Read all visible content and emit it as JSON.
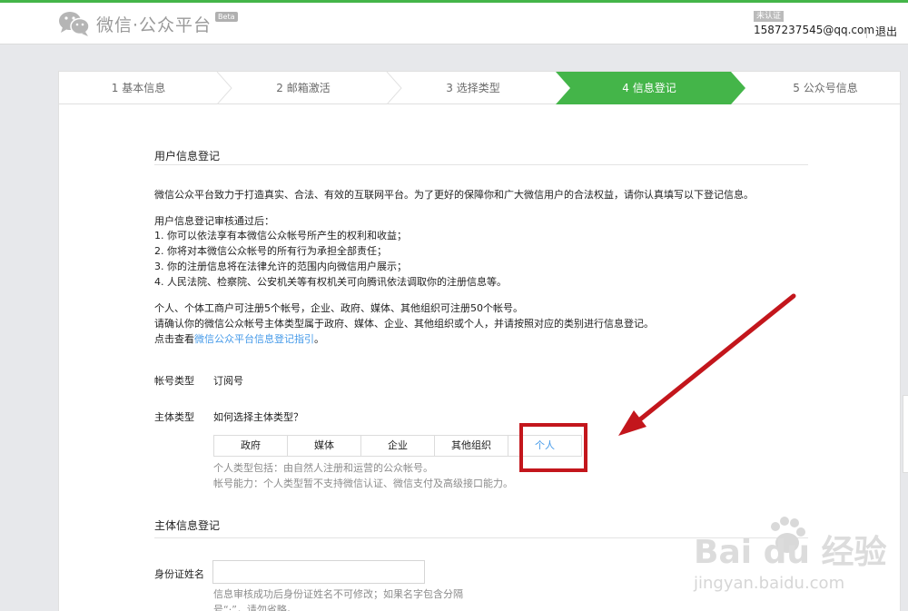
{
  "header": {
    "logo_text": "微信·公众平台",
    "beta": "Beta",
    "unverified": "未认证",
    "email": "1587237545@qq.com",
    "logout": "退出"
  },
  "steps": [
    {
      "label": "1 基本信息",
      "active": false
    },
    {
      "label": "2 邮箱激活",
      "active": false
    },
    {
      "label": "3 选择类型",
      "active": false
    },
    {
      "label": "4 信息登记",
      "active": true
    },
    {
      "label": "5 公众号信息",
      "active": false
    }
  ],
  "section1_title": "用户信息登记",
  "intro": "微信公众平台致力于打造真实、合法、有效的互联网平台。为了更好的保障你和广大微信用户的合法权益，请你认真填写以下登记信息。",
  "audit": {
    "head": "用户信息登记审核通过后：",
    "items": [
      "1. 你可以依法享有本微信公众帐号所产生的权利和收益；",
      "2. 你将对本微信公众帐号的所有行为承担全部责任；",
      "3. 你的注册信息将在法律允许的范围内向微信用户展示；",
      "4. 人民法院、检察院、公安机关等有权机关可向腾讯依法调取你的注册信息等。"
    ]
  },
  "limits": {
    "line1": "个人、个体工商户可注册5个帐号，企业、政府、媒体、其他组织可注册50个帐号。",
    "line2": "请确认你的微信公众帐号主体类型属于政府、媒体、企业、其他组织或个人，并请按照对应的类别进行信息登记。",
    "line3_prefix": "点击查看",
    "line3_link": "微信公众平台信息登记指引",
    "line3_suffix": "。"
  },
  "account_type": {
    "label": "帐号类型",
    "value": "订阅号"
  },
  "subject_type": {
    "label": "主体类型",
    "help_link": "如何选择主体类型？",
    "options": [
      "政府",
      "媒体",
      "企业",
      "其他组织",
      "个人"
    ],
    "selected": "个人",
    "hint1": "个人类型包括：由自然人注册和运营的公众帐号。",
    "hint2": "帐号能力：个人类型暂不支持微信认证、微信支付及高级接口能力。"
  },
  "section2_title": "主体信息登记",
  "id_name": {
    "label": "身份证姓名",
    "value": "",
    "hint1": "信息审核成功后身份证姓名不可修改；如果名字包含分隔",
    "hint2": "号“·”，请勿省略。"
  },
  "watermark": {
    "text": "Bai du 经验",
    "url": "jingyan.baidu.com"
  },
  "colors": {
    "green": "#44b549",
    "link": "#459ae9",
    "annotation_red": "#c3161c"
  }
}
